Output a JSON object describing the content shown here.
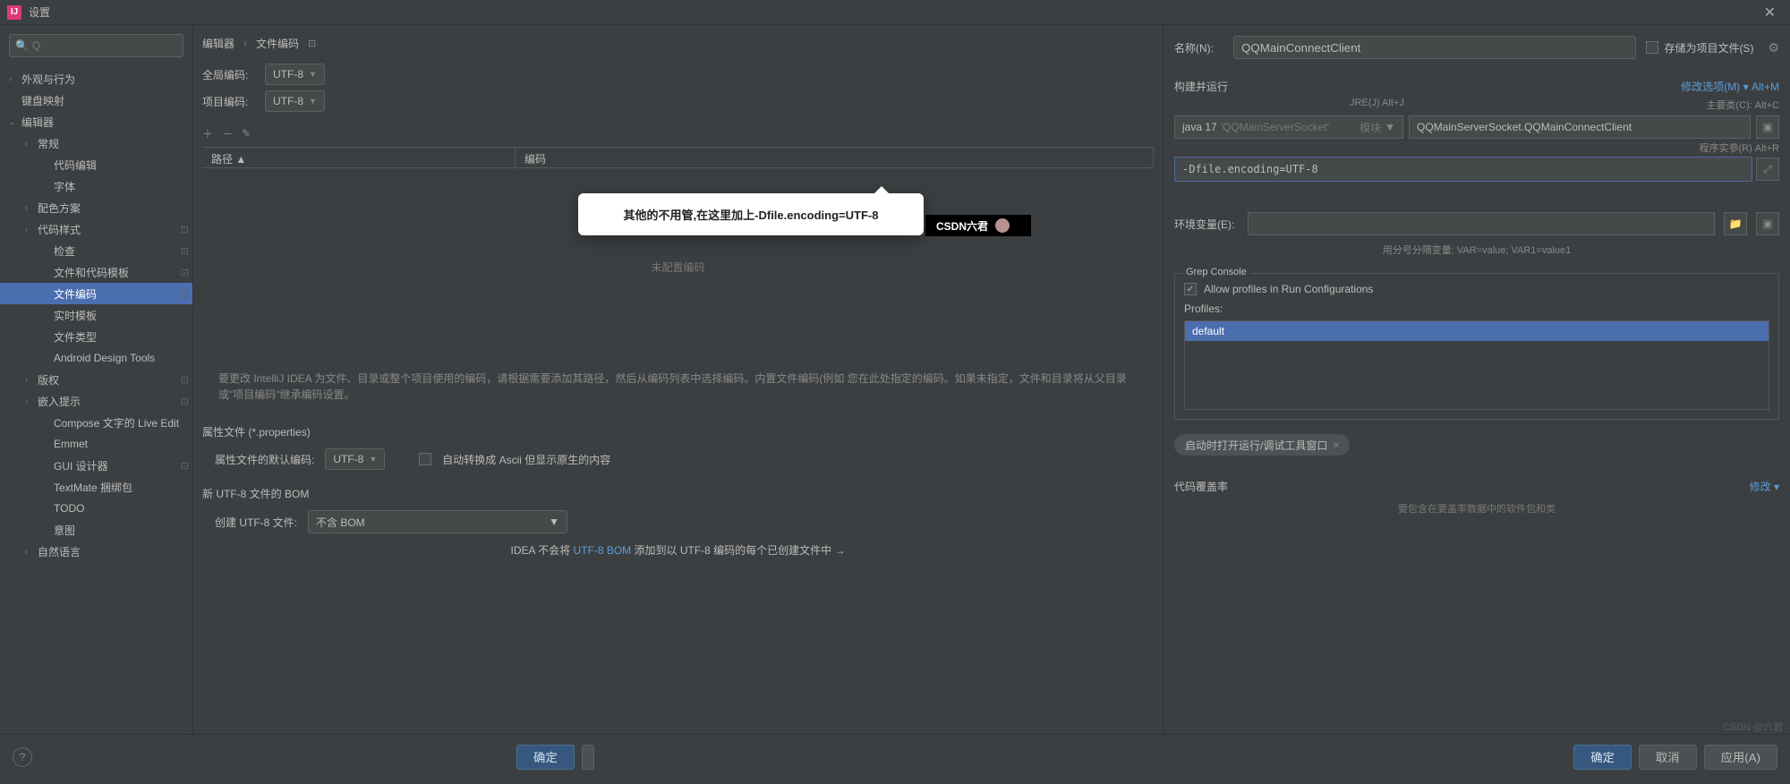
{
  "title_bar": {
    "app_icon": "IJ",
    "title": "设置"
  },
  "search": {
    "placeholder": "Q"
  },
  "tree": {
    "items": [
      {
        "label": "外观与行为",
        "chev": "›",
        "lv": 0
      },
      {
        "label": "键盘映射",
        "chev": "",
        "lv": 0
      },
      {
        "label": "编辑器",
        "chev": "⌄",
        "lv": 0
      },
      {
        "label": "常规",
        "chev": "›",
        "lv": 1
      },
      {
        "label": "代码编辑",
        "chev": "",
        "lv": 2
      },
      {
        "label": "字体",
        "chev": "",
        "lv": 2
      },
      {
        "label": "配色方案",
        "chev": "›",
        "lv": 1
      },
      {
        "label": "代码样式",
        "chev": "›",
        "lv": 1,
        "pin": "⊡"
      },
      {
        "label": "检查",
        "chev": "",
        "lv": 2,
        "pin": "⊡"
      },
      {
        "label": "文件和代码模板",
        "chev": "",
        "lv": 2,
        "pin": "⊡"
      },
      {
        "label": "文件编码",
        "chev": "",
        "lv": 2,
        "pin": "⊡",
        "selected": true
      },
      {
        "label": "实时模板",
        "chev": "",
        "lv": 2
      },
      {
        "label": "文件类型",
        "chev": "",
        "lv": 2
      },
      {
        "label": "Android Design Tools",
        "chev": "",
        "lv": 2
      },
      {
        "label": "版权",
        "chev": "›",
        "lv": 1,
        "pin": "⊡"
      },
      {
        "label": "嵌入提示",
        "chev": "›",
        "lv": 1,
        "pin": "⊡"
      },
      {
        "label": "Compose 文字的 Live Edit",
        "chev": "",
        "lv": 2
      },
      {
        "label": "Emmet",
        "chev": "",
        "lv": 2
      },
      {
        "label": "GUI 设计器",
        "chev": "",
        "lv": 2,
        "pin": "⊡"
      },
      {
        "label": "TextMate 捆绑包",
        "chev": "",
        "lv": 2
      },
      {
        "label": "TODO",
        "chev": "",
        "lv": 2
      },
      {
        "label": "意图",
        "chev": "",
        "lv": 2
      },
      {
        "label": "自然语言",
        "chev": "›",
        "lv": 1
      }
    ]
  },
  "crumbs": {
    "a": "编辑器",
    "b": "文件编码",
    "reset": "⊡"
  },
  "enc": {
    "global_label": "全局编码:",
    "global_val": "UTF-8",
    "project_label": "项目编码:",
    "project_val": "UTF-8"
  },
  "table": {
    "hdr_path": "路径 ▲",
    "hdr_enc": "编码",
    "empty": "未配置编码"
  },
  "note": "要更改 IntelliJ IDEA 为文件、目录或整个项目使用的编码，请根据需要添加其路径，然后从编码列表中选择编码。内置文件编码(例如 您在此处指定的编码。如果未指定，文件和目录将从父目录或\"项目编码\"继承编码设置。",
  "props": {
    "header": "属性文件 (*.properties)",
    "default_label": "属性文件的默认编码:",
    "default_val": "UTF-8",
    "ascii_label": "自动转换成 Ascii 但显示原生的内容"
  },
  "bom": {
    "header": "新 UTF-8 文件的 BOM",
    "create_label": "创建 UTF-8 文件:",
    "create_val": "不含 BOM",
    "note_pre": "IDEA 不会将 ",
    "note_link": "UTF-8 BOM",
    "note_post": " 添加到以 UTF-8 编码的每个已创建文件中 →"
  },
  "right": {
    "name_label": "名称(N):",
    "name_value": "QQMainConnectClient",
    "save_as_label": "存储为项目文件(S)",
    "build_header": "构建并运行",
    "hint_jre": "JRE(J) Alt+J",
    "hint_mod": "修改选项(M) ▾   Alt+M",
    "hint_main": "主要类(C): Alt+C",
    "jre_val": "java 17",
    "jre_proj": "'QQMainServerSocket'",
    "module_label": "模块",
    "main_class": "QQMainServerSocket.QQMainConnectClient",
    "hint_args": "程序实参(R) Alt+R",
    "vm_opts": "-Dfile.encoding=UTF-8",
    "env_label": "环境变量(E):",
    "env_hint": "用分号分隔变量: VAR=value; VAR1=value1",
    "grep_legend": "Grep Console",
    "grep_check": "Allow profiles in Run Configurations",
    "profiles_label": "Profiles:",
    "profile_default": "default",
    "tag_label": "启动时打开运行/调试工具窗口",
    "coverage_label": "代码覆盖率",
    "modify_link": "修改 ▾",
    "cov_hint": "要包含在要盖率数据中的软件包和类"
  },
  "footer": {
    "ok": "确定",
    "cancel": "取消",
    "apply": "应用(A)"
  },
  "callout": "其他的不用管,在这里加上-Dfile.encoding=UTF-8",
  "watermark": "CSDN六君",
  "bottom_watermark": "CSDN @六君"
}
